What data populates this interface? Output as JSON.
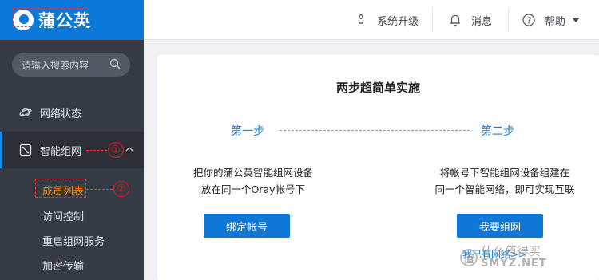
{
  "sidebar": {
    "logo_text": "蒲公英",
    "search_placeholder": "请输入搜索内容",
    "items": [
      {
        "label": "网络状态",
        "icon": "planet-icon"
      },
      {
        "label": "智能组网",
        "icon": "network-icon",
        "expanded": true
      }
    ],
    "subitems": [
      {
        "label": "成员列表",
        "active": true
      },
      {
        "label": "访问控制"
      },
      {
        "label": "重启组网服务"
      },
      {
        "label": "加密传输"
      }
    ]
  },
  "annotations": {
    "callout_1": "①",
    "callout_2": "②",
    "color": "#e01e1e"
  },
  "topbar": {
    "upgrade_label": "系统升级",
    "messages_label": "消息",
    "help_label": "帮助"
  },
  "main": {
    "title": "两步超简单实施",
    "step1_label": "第一步",
    "step2_label": "第二步",
    "step1_desc_line1": "把你的蒲公英智能组网设备",
    "step1_desc_line2": "放在同一个Oray帐号下",
    "step2_desc_line1": "将帐号下智能组网设备组建在",
    "step2_desc_line2": "同一个智能网络，即可实现互联",
    "bind_button": "绑定帐号",
    "mesh_button": "我要组网",
    "existing_link": "我已有网络>>"
  },
  "watermark": {
    "symbol": "值",
    "cn": "什么值得买",
    "en": "SMYZ.NET"
  },
  "colors": {
    "brand": "#0a78d8",
    "sidebar_bg": "#353b45",
    "accent_orange": "#f08a18",
    "button_blue": "#0f77d6"
  }
}
